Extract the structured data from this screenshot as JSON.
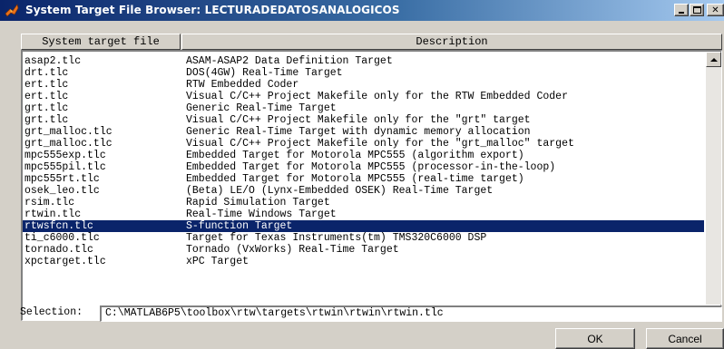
{
  "window": {
    "title": "System Target File Browser: LECTURADEDATOSANALOGICOS",
    "icon": "matlab-logo-icon",
    "controls": {
      "minimize": "minimize-icon",
      "maximize": "maximize-icon",
      "close": "close-icon"
    }
  },
  "table": {
    "headers": {
      "file": "System target file",
      "description": "Description"
    },
    "selected_index": 14,
    "rows": [
      {
        "file": "asap2.tlc",
        "description": "ASAM-ASAP2 Data Definition Target"
      },
      {
        "file": "drt.tlc",
        "description": "DOS(4GW) Real-Time Target"
      },
      {
        "file": "ert.tlc",
        "description": "RTW Embedded Coder"
      },
      {
        "file": "ert.tlc",
        "description": "Visual C/C++ Project Makefile only for the RTW Embedded Coder"
      },
      {
        "file": "grt.tlc",
        "description": "Generic Real-Time Target"
      },
      {
        "file": "grt.tlc",
        "description": "Visual C/C++ Project Makefile only for the \"grt\" target"
      },
      {
        "file": "grt_malloc.tlc",
        "description": "Generic Real-Time Target with dynamic memory allocation"
      },
      {
        "file": "grt_malloc.tlc",
        "description": "Visual C/C++ Project Makefile only for the \"grt_malloc\" target"
      },
      {
        "file": "mpc555exp.tlc",
        "description": "Embedded Target for Motorola MPC555 (algorithm export)"
      },
      {
        "file": "mpc555pil.tlc",
        "description": "Embedded Target for Motorola MPC555 (processor-in-the-loop)"
      },
      {
        "file": "mpc555rt.tlc",
        "description": "Embedded Target for Motorola MPC555 (real-time target)"
      },
      {
        "file": "osek_leo.tlc",
        "description": "(Beta) LE/O (Lynx-Embedded OSEK) Real-Time Target"
      },
      {
        "file": "rsim.tlc",
        "description": "Rapid Simulation Target"
      },
      {
        "file": "rtwin.tlc",
        "description": "Real-Time Windows Target"
      },
      {
        "file": "rtwsfcn.tlc",
        "description": "S-function Target"
      },
      {
        "file": "ti_c6000.tlc",
        "description": "Target for Texas Instruments(tm) TMS320C6000 DSP"
      },
      {
        "file": "tornado.tlc",
        "description": "Tornado (VxWorks) Real-Time Target"
      },
      {
        "file": "xpctarget.tlc",
        "description": "xPC Target"
      }
    ]
  },
  "selection": {
    "label": "Selection:",
    "value": "C:\\MATLAB6P5\\toolbox\\rtw\\targets\\rtwin\\rtwin\\rtwin.tlc"
  },
  "buttons": {
    "ok": "OK",
    "cancel": "Cancel"
  },
  "colors": {
    "titlebar_start": "#0a246a",
    "titlebar_end": "#a6caf0",
    "selection_bg": "#0a246a",
    "face": "#d4d0c8"
  }
}
